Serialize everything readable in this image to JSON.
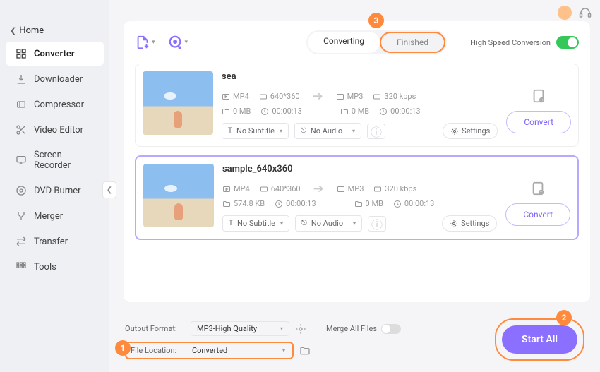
{
  "window": {
    "home": "Home"
  },
  "sidebar": {
    "items": [
      {
        "label": "Converter",
        "icon": "grid"
      },
      {
        "label": "Downloader",
        "icon": "download"
      },
      {
        "label": "Compressor",
        "icon": "compress"
      },
      {
        "label": "Video Editor",
        "icon": "scissors"
      },
      {
        "label": "Screen Recorder",
        "icon": "monitor"
      },
      {
        "label": "DVD Burner",
        "icon": "disc"
      },
      {
        "label": "Merger",
        "icon": "merge"
      },
      {
        "label": "Transfer",
        "icon": "transfer"
      },
      {
        "label": "Tools",
        "icon": "tools"
      }
    ]
  },
  "tabs": {
    "converting": "Converting",
    "finished": "Finished"
  },
  "high_speed_label": "High Speed Conversion",
  "callouts": {
    "one": "1",
    "two": "2",
    "three": "3"
  },
  "files": [
    {
      "title": "sea",
      "src": {
        "format": "MP4",
        "size": "0 MB",
        "res": "640*360",
        "dur": "00:00:13"
      },
      "dst": {
        "format": "MP3",
        "size": "0 MB",
        "rate": "320 kbps",
        "dur": "00:00:13"
      },
      "subtitle": "No Subtitle",
      "audio": "No Audio",
      "settings": "Settings",
      "convert": "Convert"
    },
    {
      "title": "sample_640x360",
      "src": {
        "format": "MP4",
        "size": "574.8 KB",
        "res": "640*360",
        "dur": "00:00:13"
      },
      "dst": {
        "format": "MP3",
        "size": "0 MB",
        "rate": "320 kbps",
        "dur": "00:00:13"
      },
      "subtitle": "No Subtitle",
      "audio": "No Audio",
      "settings": "Settings",
      "convert": "Convert"
    }
  ],
  "bottom": {
    "output_format_label": "Output Format:",
    "output_format_value": "MP3-High Quality",
    "merge_label": "Merge All Files",
    "file_location_label": "File Location:",
    "file_location_value": "Converted",
    "start_all": "Start All"
  }
}
